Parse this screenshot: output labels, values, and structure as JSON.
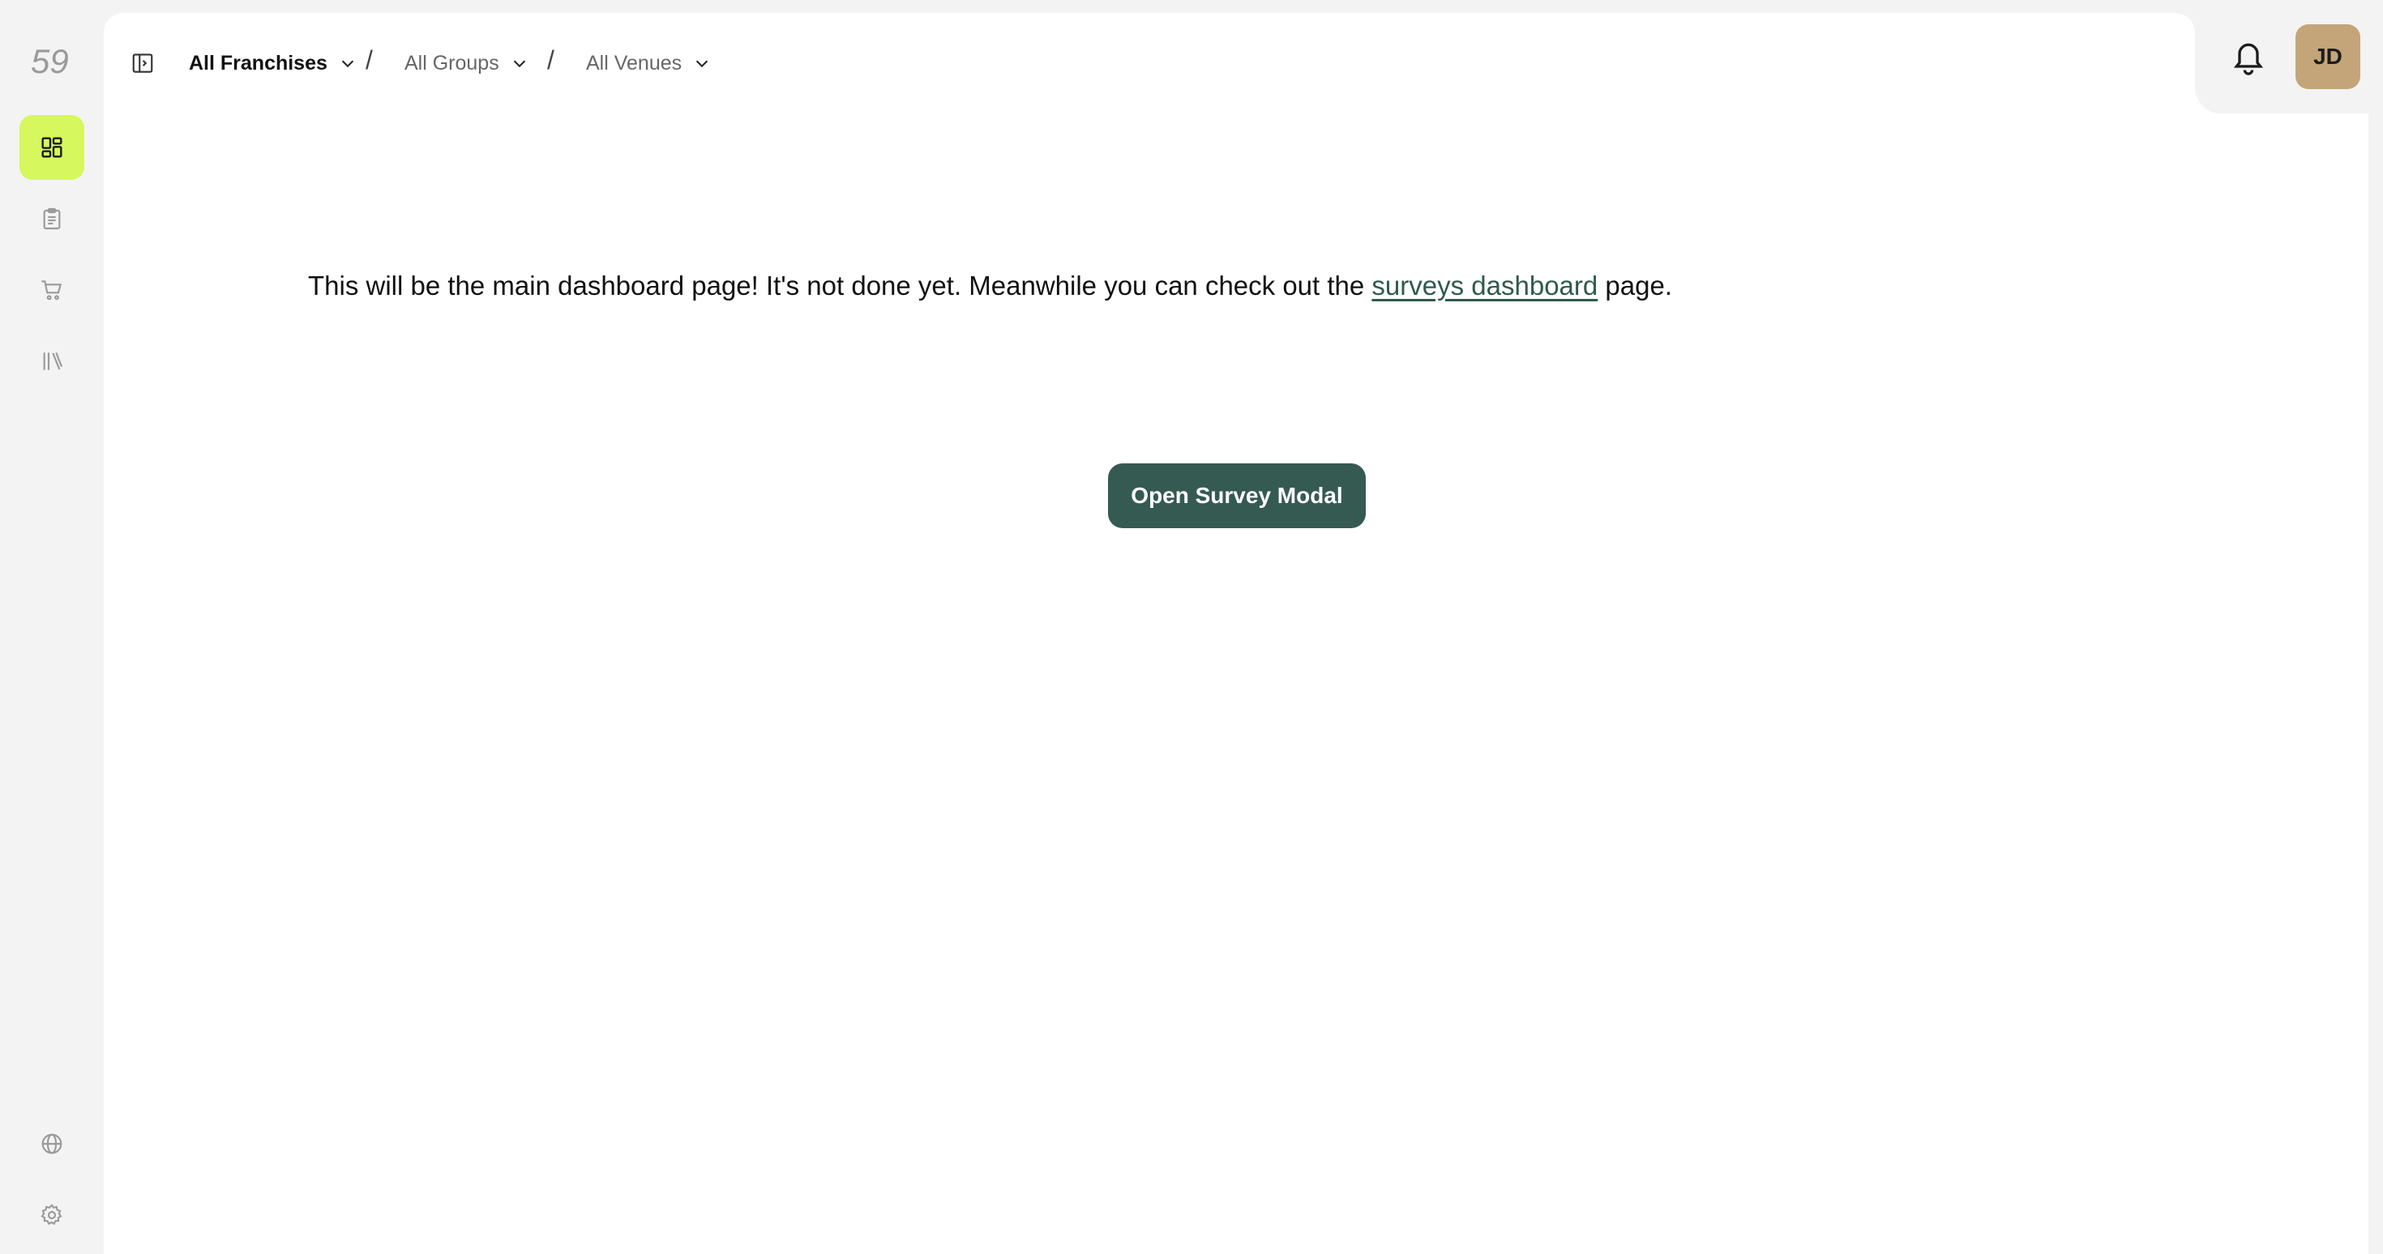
{
  "brand": {
    "logo_text": "59"
  },
  "sidebar": {
    "items": [
      {
        "name": "dashboard",
        "icon": "dashboard-icon",
        "active": true
      },
      {
        "name": "surveys",
        "icon": "clipboard-icon",
        "active": false
      },
      {
        "name": "orders",
        "icon": "cart-icon",
        "active": false
      },
      {
        "name": "library",
        "icon": "library-icon",
        "active": false
      }
    ],
    "bottom_items": [
      {
        "name": "language",
        "icon": "globe-icon"
      },
      {
        "name": "settings",
        "icon": "gear-icon"
      }
    ]
  },
  "header": {
    "breadcrumbs": [
      {
        "label": "All Franchises"
      },
      {
        "label": "All Groups"
      },
      {
        "label": "All Venues"
      }
    ],
    "separator": "/",
    "user_initials": "JD"
  },
  "main": {
    "message_before": "This will be the main dashboard page! It's not done yet. Meanwhile you can check out the ",
    "link_text": "surveys dashboard",
    "message_after": " page.",
    "button_label": "Open Survey Modal"
  },
  "colors": {
    "accent": "#d6f75e",
    "primary": "#355a52",
    "link": "#2f5a4d",
    "avatar": "#c4a57a"
  }
}
